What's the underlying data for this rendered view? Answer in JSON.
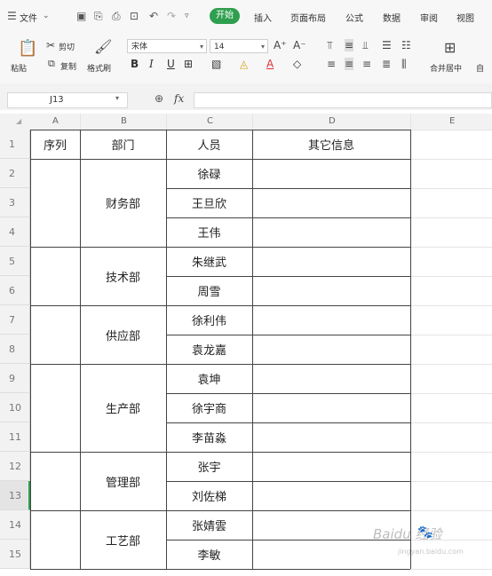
{
  "menubar": {
    "file_label": "文件",
    "tabs": [
      "开始",
      "插入",
      "页面布局",
      "公式",
      "数据",
      "审阅",
      "视图"
    ]
  },
  "ribbon": {
    "paste": "粘贴",
    "cut": "剪切",
    "copy": "复制",
    "format_painter": "格式刷",
    "font_name": "宋体",
    "font_size": "14",
    "bold": "B",
    "italic": "I",
    "underline": "U",
    "merge_center": "合并居中",
    "auto_wrap": "自"
  },
  "formula_bar": {
    "cell_ref": "J13",
    "fx": "fx",
    "value": ""
  },
  "sheet": {
    "columns": [
      "A",
      "B",
      "C",
      "D",
      "E"
    ],
    "rows": [
      "1",
      "2",
      "3",
      "4",
      "5",
      "6",
      "7",
      "8",
      "9",
      "10",
      "11",
      "12",
      "13",
      "14",
      "15"
    ],
    "headers": [
      "序列",
      "部门",
      "人员",
      "其它信息"
    ],
    "departments": [
      "财务部",
      "技术部",
      "供应部",
      "生产部",
      "管理部",
      "工艺部"
    ],
    "people": [
      "徐碌",
      "王旦欣",
      "王伟",
      "朱继武",
      "周雪",
      "徐利伟",
      "袁龙嘉",
      "袁坤",
      "徐宇商",
      "李苗淼",
      "张宇",
      "刘佐梯",
      "张婧雲",
      "李敏"
    ]
  },
  "watermark": {
    "brand": "Baidu 经验",
    "url": "jingyan.baidu.com"
  }
}
